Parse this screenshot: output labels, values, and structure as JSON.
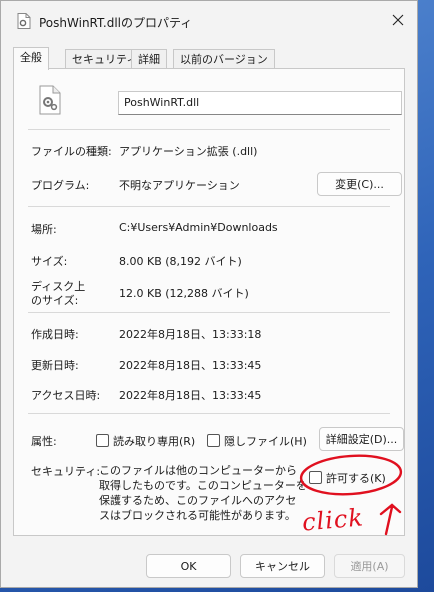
{
  "window": {
    "title": "PoshWinRT.dllのプロパティ",
    "close_icon": "close-icon"
  },
  "tabs": [
    {
      "label": "全般",
      "active": true
    },
    {
      "label": "セキュリティ",
      "active": false
    },
    {
      "label": "詳細",
      "active": false
    },
    {
      "label": "以前のバージョン",
      "active": false
    }
  ],
  "general": {
    "file_name": "PoshWinRT.dll",
    "file_icon": "dll-gear-file-icon",
    "type_label": "ファイルの種類:",
    "type_value": "アプリケーション拡張 (.dll)",
    "program_label": "プログラム:",
    "program_value": "不明なアプリケーション",
    "change_button": "変更(C)...",
    "location_label": "場所:",
    "location_value": "C:¥Users¥Admin¥Downloads",
    "size_label": "サイズ:",
    "size_value": "8.00 KB (8,192 バイト)",
    "disk_size_label_line1": "ディスク上",
    "disk_size_label_line2": "のサイズ:",
    "disk_size_value": "12.0 KB (12,288 バイト)",
    "created_label": "作成日時:",
    "created_value": "2022年8月18日、13:33:18",
    "modified_label": "更新日時:",
    "modified_value": "2022年8月18日、13:33:45",
    "accessed_label": "アクセス日時:",
    "accessed_value": "2022年8月18日、13:33:45",
    "attributes_label": "属性:",
    "readonly_label": "読み取り専用(R)",
    "readonly_checked": false,
    "hidden_label": "隠しファイル(H)",
    "hidden_checked": false,
    "advanced_button": "詳細設定(D)...",
    "security_label": "セキュリティ:",
    "security_text": "このファイルは他のコンピューターから取得したものです。このコンピューターを保護するため、このファイルへのアクセスはブロックされる可能性があります。",
    "unblock_label": "許可する(K)",
    "unblock_checked": false
  },
  "annotation": {
    "text": "click",
    "color": "#e0101f"
  },
  "footer": {
    "ok": "OK",
    "cancel": "キャンセル",
    "apply": "適用(A)",
    "apply_enabled": false
  }
}
